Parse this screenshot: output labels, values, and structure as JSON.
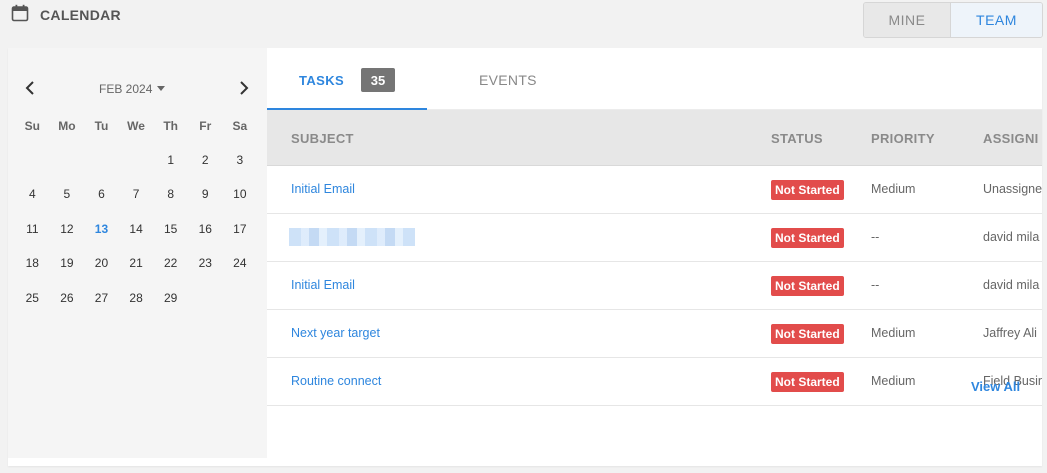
{
  "header": {
    "title": "CALENDAR"
  },
  "toggle": {
    "mine": "MINE",
    "team": "TEAM",
    "active": "TEAM"
  },
  "calendar": {
    "month": "FEB 2024",
    "days_of_week": [
      "Su",
      "Mo",
      "Tu",
      "We",
      "Th",
      "Fr",
      "Sa"
    ],
    "weeks": [
      [
        "",
        "",
        "",
        "",
        "1",
        "2",
        "3"
      ],
      [
        "4",
        "5",
        "6",
        "7",
        "8",
        "9",
        "10"
      ],
      [
        "11",
        "12",
        "13",
        "14",
        "15",
        "16",
        "17"
      ],
      [
        "18",
        "19",
        "20",
        "21",
        "22",
        "23",
        "24"
      ],
      [
        "25",
        "26",
        "27",
        "28",
        "29",
        "",
        ""
      ]
    ],
    "today": "13"
  },
  "tabs": {
    "tasks": "TASKS",
    "tasks_count": "35",
    "events": "EVENTS",
    "active": "TASKS"
  },
  "table": {
    "headers": {
      "subject": "SUBJECT",
      "status": "STATUS",
      "priority": "PRIORITY",
      "assigned": "ASSIGNI"
    },
    "rows": [
      {
        "subject": "Initial Email",
        "status": "Not Started",
        "priority": "Medium",
        "assigned": "Unassigne"
      },
      {
        "subject": "",
        "status": "Not Started",
        "priority": "--",
        "assigned": "david mila"
      },
      {
        "subject": "Initial Email",
        "status": "Not Started",
        "priority": "--",
        "assigned": "david mila"
      },
      {
        "subject": "Next year target",
        "status": "Not Started",
        "priority": "Medium",
        "assigned": "Jaffrey Ali"
      },
      {
        "subject": "Routine connect",
        "status": "Not Started",
        "priority": "Medium",
        "assigned": "Field Busin"
      }
    ]
  },
  "footer": {
    "view_all": "View All"
  },
  "colors": {
    "accent": "#2e86de",
    "status_red": "#e24c4b",
    "badge_gray": "#757575"
  },
  "icons": {
    "header_icon": "calendar-icon",
    "prev": "chevron-left-icon",
    "next": "chevron-right-icon",
    "month_dropdown": "caret-down-icon"
  }
}
